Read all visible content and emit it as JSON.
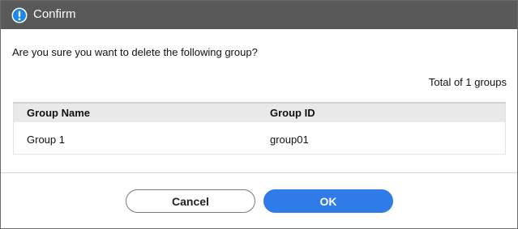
{
  "dialog": {
    "title": "Confirm",
    "icon": "info-exclamation-icon",
    "message": "Are you sure you want to delete the following group?",
    "total": "Total of 1 groups"
  },
  "table": {
    "columns": [
      "Group Name",
      "Group ID"
    ],
    "rows": [
      [
        "Group 1",
        "group01"
      ]
    ]
  },
  "buttons": {
    "cancel_label": "Cancel",
    "ok_label": "OK"
  },
  "colors": {
    "titlebar": "#595959",
    "accent": "#2f7be8",
    "icon": "#1e88e5"
  }
}
